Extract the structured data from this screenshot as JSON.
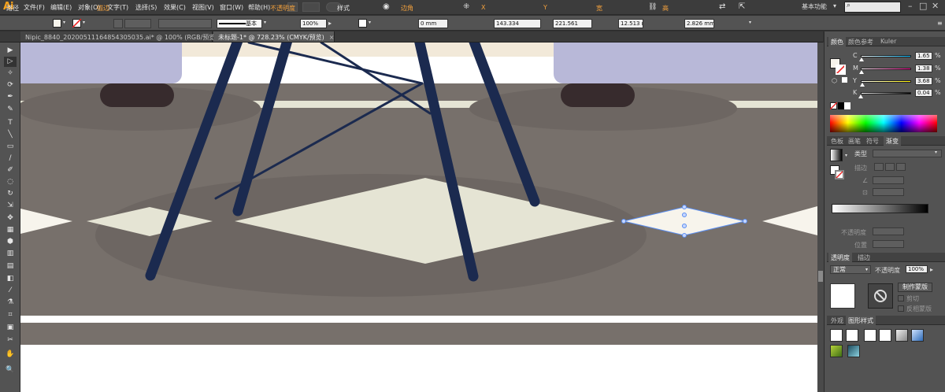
{
  "app": {
    "logo": "Ai"
  },
  "menu": [
    "文件(F)",
    "编辑(E)",
    "对象(O)",
    "文字(T)",
    "选择(S)",
    "效果(C)",
    "视图(V)",
    "窗口(W)",
    "帮助(H)"
  ],
  "workspace": "基本功能",
  "window_controls": {
    "minimize": "–",
    "restore": "□",
    "close": "✕"
  },
  "control_bar": {
    "object_type": "路径",
    "stroke_label": "描边",
    "stroke_style": "基本",
    "opacity_label": "不透明度",
    "opacity_value": "100%",
    "style_label": "样式",
    "corner_label": "边角",
    "corner_value": "0 mm",
    "x_label": "X",
    "x_value": "143.334",
    "y_label": "Y",
    "y_value": "221.561",
    "w_label": "宽",
    "w_value": "12.513 mm",
    "h_label": "高",
    "h_value": "2.826 mm"
  },
  "tabs": [
    {
      "label": "Nipic_8840_20200511164854305035.ai* @ 100% (RGB/预览)",
      "active": false
    },
    {
      "label": "未标题-1* @ 728.23% (CMYK/预览)",
      "active": true
    }
  ],
  "tab_close": "×",
  "tools": [
    "▶",
    "▷",
    "✧",
    "⟳",
    "✒",
    "✎",
    "T",
    "╲",
    "▭",
    "∕",
    "✐",
    "◌",
    "↻",
    "⇲",
    "✥",
    "▦",
    "⬢",
    "▥",
    "▤",
    "◧",
    "⁄",
    "⚗",
    "⌗",
    "▣",
    "✂",
    "✋",
    "🔍"
  ],
  "color_panel": {
    "tabs": [
      "颜色",
      "颜色参考",
      "Kuler"
    ],
    "channels": [
      {
        "label": "C",
        "value": "1.65",
        "pos": 0.0165
      },
      {
        "label": "M",
        "value": "1.38",
        "pos": 0.0138
      },
      {
        "label": "Y",
        "value": "3.68",
        "pos": 0.0368
      },
      {
        "label": "K",
        "value": "0.04",
        "pos": 0.0004
      }
    ],
    "fill_color": "#f7f4ec"
  },
  "gradient_panel": {
    "tabs": [
      "色板",
      "画笔",
      "符号",
      "渐变"
    ],
    "type_label": "类型",
    "stroke_label": "描边",
    "opacity_label": "不透明度",
    "position_label": "位置"
  },
  "transparency_panel": {
    "tabs": [
      "透明度",
      "描边"
    ],
    "blend_mode": "正常",
    "opacity_label": "不透明度",
    "opacity_value": "100%",
    "make_mask": "制作蒙版",
    "clip": "剪切",
    "invert_mask": "反相蒙版"
  },
  "styles_panel": {
    "tabs": [
      "外观",
      "图形样式"
    ]
  },
  "colors": {
    "wall": "#77706b",
    "floor_white": "#f7f4ec",
    "leg": "#1b2a4f",
    "cushion": "#b8b8d8",
    "foot": "#372b2d",
    "strip": "#e5e4d4",
    "shadow": "#6d6662",
    "accent": "#f2a03c"
  }
}
